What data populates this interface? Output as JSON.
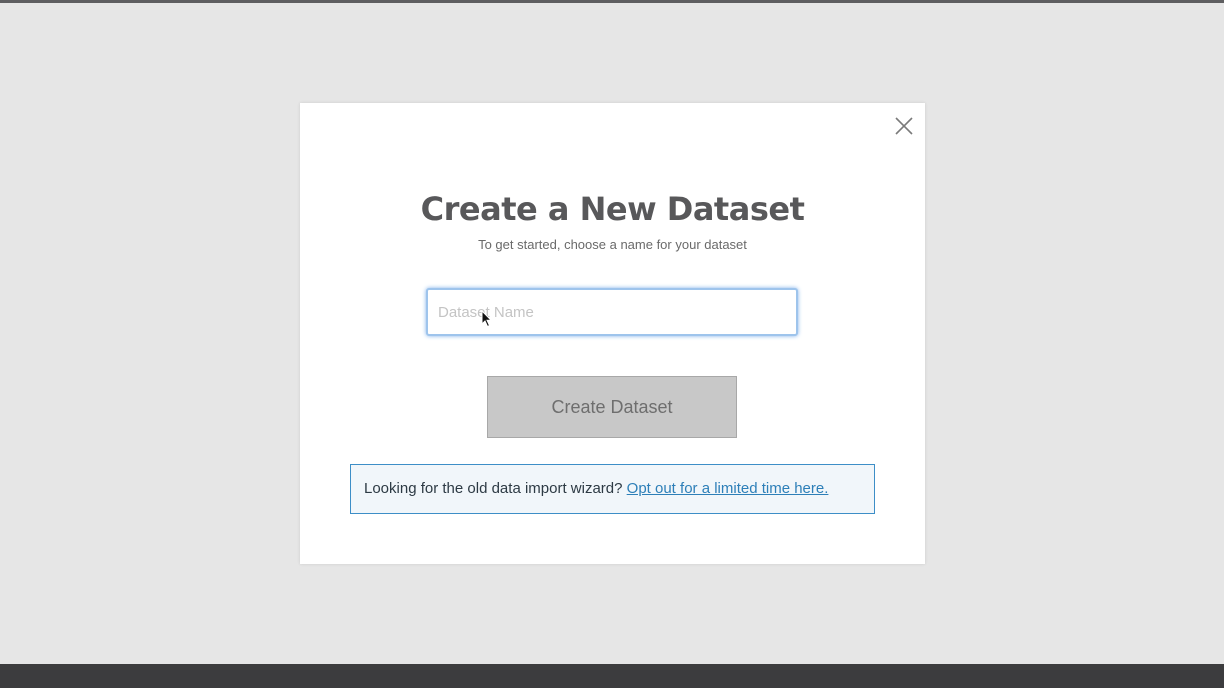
{
  "modal": {
    "title": "Create a New Dataset",
    "subtitle": "To get started, choose a name for your dataset",
    "input": {
      "placeholder": "Dataset Name",
      "value": ""
    },
    "create_button_label": "Create Dataset",
    "notice": {
      "text": "Looking for the old data import wizard?",
      "link_label": "Opt out for a limited time here."
    },
    "icons": {
      "close": "close-icon",
      "cursor": "mouse-cursor-icon"
    }
  },
  "colors": {
    "background": "#e6e6e6",
    "title": "#58585a",
    "input_focus": "#9ec4ec",
    "button_disabled": "#c8c8c8",
    "notice_border": "#3d8ec7",
    "link": "#2d7fb8"
  }
}
